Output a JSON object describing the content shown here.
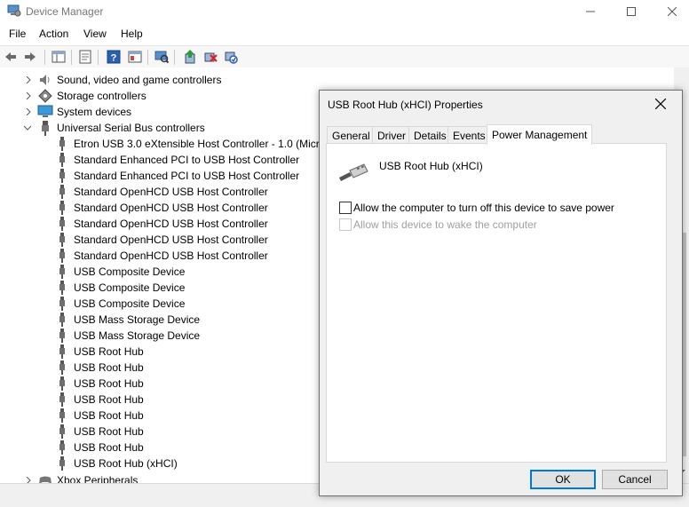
{
  "window": {
    "title": "Device Manager"
  },
  "menu": [
    "File",
    "Action",
    "View",
    "Help"
  ],
  "tree": {
    "categories_top": [
      {
        "label": "Sound, video and game controllers",
        "icon": "speaker-icon"
      },
      {
        "label": "Storage controllers",
        "icon": "storage-controller-icon"
      },
      {
        "label": "System devices",
        "icon": "monitor-icon"
      },
      {
        "label": "Universal Serial Bus controllers",
        "icon": "usb-icon",
        "expanded": true
      }
    ],
    "usb_devices": [
      "Etron USB 3.0 eXtensible Host Controller - 1.0 (Micro",
      "Standard Enhanced PCI to USB Host Controller",
      "Standard Enhanced PCI to USB Host Controller",
      "Standard OpenHCD USB Host Controller",
      "Standard OpenHCD USB Host Controller",
      "Standard OpenHCD USB Host Controller",
      "Standard OpenHCD USB Host Controller",
      "Standard OpenHCD USB Host Controller",
      "USB Composite Device",
      "USB Composite Device",
      "USB Composite Device",
      "USB Mass Storage Device",
      "USB Mass Storage Device",
      "USB Root Hub",
      "USB Root Hub",
      "USB Root Hub",
      "USB Root Hub",
      "USB Root Hub",
      "USB Root Hub",
      "USB Root Hub",
      "USB Root Hub (xHCI)"
    ],
    "category_bottom": {
      "label": "Xbox Peripherals"
    }
  },
  "dialog": {
    "title": "USB Root Hub (xHCI) Properties",
    "tabs": [
      "General",
      "Driver",
      "Details",
      "Events",
      "Power Management"
    ],
    "active_tab": "Power Management",
    "device_name": "USB Root Hub (xHCI)",
    "option_turn_off": "Allow the computer to turn off this device to save power",
    "option_wake": "Allow this device to wake the computer",
    "ok_label": "OK",
    "cancel_label": "Cancel"
  },
  "colors": {
    "accent": "#0078d7",
    "disabled_text": "#a0a0a0"
  }
}
